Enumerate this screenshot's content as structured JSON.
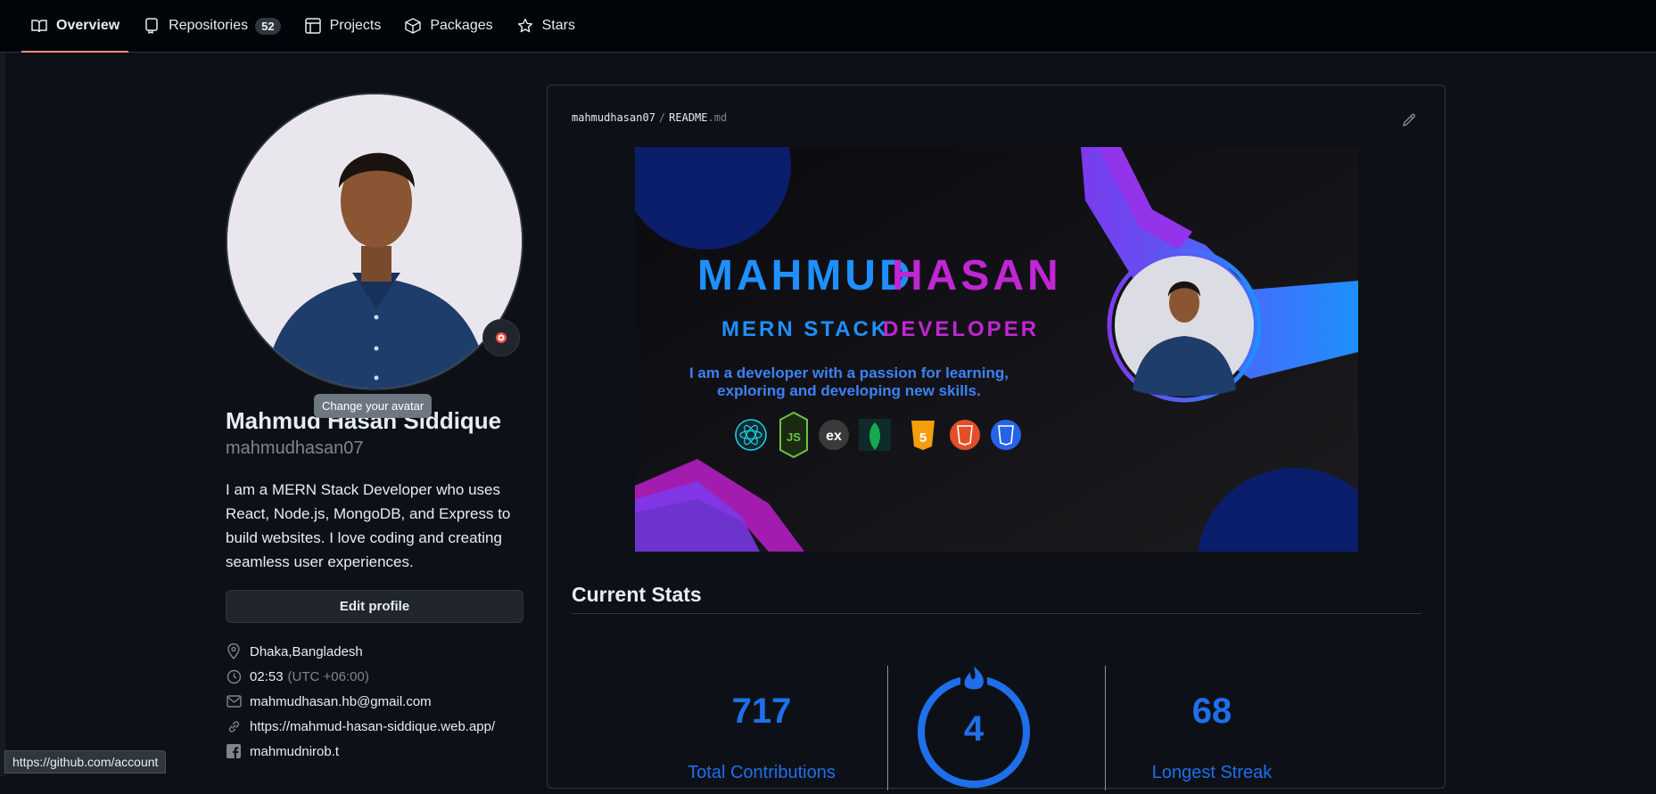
{
  "nav": {
    "tabs": [
      {
        "label": "Overview",
        "icon": "book-icon",
        "active": true
      },
      {
        "label": "Repositories",
        "icon": "repo-icon",
        "count": "52"
      },
      {
        "label": "Projects",
        "icon": "table-icon"
      },
      {
        "label": "Packages",
        "icon": "package-icon"
      },
      {
        "label": "Stars",
        "icon": "star-icon"
      }
    ]
  },
  "profile": {
    "tooltip": "Change your avatar",
    "full_name": "Mahmud Hasan Siddique",
    "login": "mahmudhasan07",
    "bio": "I am a MERN Stack Developer who uses React, Node.js, MongoDB, and Express to build websites. I love coding and creating seamless user experiences.",
    "edit_label": "Edit profile",
    "location": "Dhaka,Bangladesh",
    "time": "02:53",
    "timezone": "(UTC +06:00)",
    "email": "mahmudhasan.hb@gmail.com",
    "website": "https://mahmud-hasan-siddique.web.app/",
    "facebook": "mahmudnirob.t"
  },
  "readme": {
    "owner": "mahmudhasan07",
    "file": "README",
    "ext": ".md",
    "banner": {
      "name_part1": "MAHMUD",
      "name_part2": "HASAN",
      "role_part1": "MERN STACK",
      "role_part2": "DEVELOPER",
      "tagline1": "I am a developer with a passion for learning,",
      "tagline2": "exploring and developing new skills."
    },
    "stats_title": "Current Stats",
    "stats": {
      "total": "717",
      "total_label": "Total Contributions",
      "current": "4",
      "longest": "68",
      "longest_label": "Longest Streak"
    }
  },
  "statusbar": "https://github.com/account",
  "colors": {
    "accent": "#1f6feb",
    "underline": "#fd8c73",
    "magenta": "#c026d3"
  }
}
